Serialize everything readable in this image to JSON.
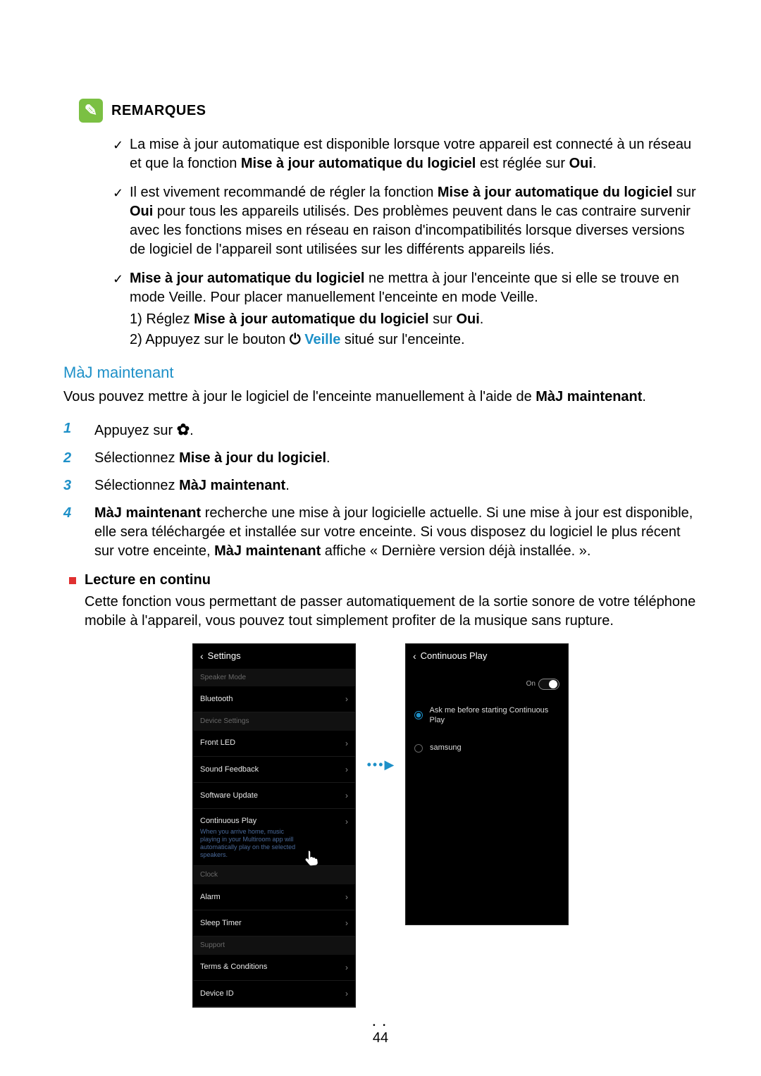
{
  "notes": {
    "heading": "REMARQUES",
    "items": [
      {
        "pre": "La mise à jour automatique est disponible lorsque votre appareil est connecté à un réseau et que la fonction ",
        "bold1": "Mise à jour automatique du logiciel",
        "mid": " est réglée sur ",
        "bold2": "Oui",
        "post": "."
      },
      {
        "pre": "Il est vivement recommandé de régler la fonction ",
        "bold1": "Mise à jour automatique du logiciel",
        "mid": " sur ",
        "bold2": "Oui",
        "post": " pour tous les appareils utilisés. Des problèmes peuvent dans le cas contraire survenir avec les fonctions mises en réseau en raison d'incompatibilités lorsque diverses versions de logiciel de l'appareil sont utilisées sur les différents appareils liés."
      },
      {
        "boldlead": "Mise à jour automatique du logiciel",
        "tail": " ne mettra à jour l'enceinte que si elle se trouve en mode Veille. Pour placer manuellement l'enceinte en mode Veille.",
        "step1_pre": "1) Réglez ",
        "step1_bold": "Mise à jour automatique du logiciel",
        "step1_mid": " sur ",
        "step1_bold2": "Oui",
        "step1_post": ".",
        "step2_pre": "2) Appuyez sur le bouton ",
        "step2_standby": "Veille",
        "step2_post": " situé sur l'enceinte."
      }
    ]
  },
  "section": {
    "title": "MàJ maintenant",
    "intro_pre": "Vous pouvez mettre à jour le logiciel de l'enceinte manuellement à l'aide de ",
    "intro_bold": "MàJ maintenant",
    "intro_post": "."
  },
  "steps": {
    "s1": "Appuyez sur ",
    "s2_pre": "Sélectionnez ",
    "s2_bold": "Mise à jour du logiciel",
    "s2_post": ".",
    "s3_pre": "Sélectionnez ",
    "s3_bold": "MàJ maintenant",
    "s3_post": ".",
    "s4_bold1": "MàJ maintenant",
    "s4_mid": " recherche une mise à jour logicielle actuelle. Si une mise à jour est disponible, elle sera téléchargée et installée sur votre enceinte. Si vous disposez du logiciel le plus récent sur votre enceinte, ",
    "s4_bold2": "MàJ maintenant",
    "s4_post": " affiche « Dernière version déjà installée. »."
  },
  "bullet": {
    "title": "Lecture en continu",
    "body": "Cette fonction vous permettant de passer automatiquement de la sortie sonore de votre téléphone mobile à l'appareil, vous pouvez tout simplement profiter de la musique sans rupture."
  },
  "phone1": {
    "header": "Settings",
    "groups": {
      "g1": "Speaker Mode",
      "g2": "Device Settings",
      "g3": "Clock",
      "g4": "Support"
    },
    "rows": {
      "bluetooth": "Bluetooth",
      "frontled": "Front LED",
      "sound": "Sound Feedback",
      "swupdate": "Software Update",
      "cplay": "Continuous Play",
      "cplay_sub": "When you arrive home, music playing in your Multiroom app will automatically play on the selected speakers.",
      "alarm": "Alarm",
      "sleep": "Sleep Timer",
      "terms": "Terms & Conditions",
      "devid": "Device ID"
    }
  },
  "phone2": {
    "header": "Continuous Play",
    "toggle": "On",
    "opt1": "Ask me before starting Continuous Play",
    "opt2": "samsung"
  },
  "page": "44"
}
